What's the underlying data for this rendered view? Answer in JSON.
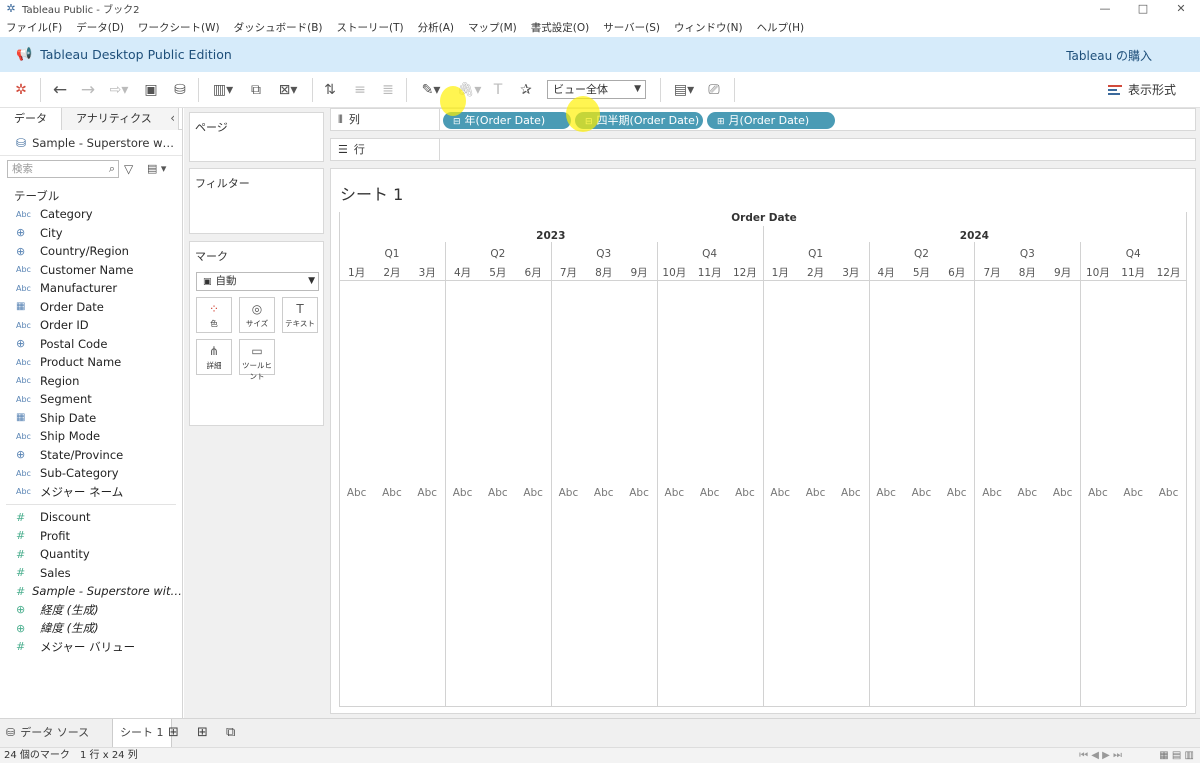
{
  "window": {
    "title": "Tableau Public - ブック2",
    "min": "—",
    "max": "□",
    "close": "✕"
  },
  "menu": [
    "ファイル(F)",
    "データ(D)",
    "ワークシート(W)",
    "ダッシュボード(B)",
    "ストーリー(T)",
    "分析(A)",
    "マップ(M)",
    "書式設定(O)",
    "サーバー(S)",
    "ウィンドウ(N)",
    "ヘルプ(H)"
  ],
  "banner": {
    "title": "Tableau Desktop Public Edition",
    "buy": "Tableau の購入"
  },
  "toolbar": {
    "view_select": "ビュー全体",
    "show_me": "表示形式"
  },
  "datapane": {
    "tab_data": "データ",
    "tab_analytics": "アナリティクス",
    "datasource": "Sample - Superstore w…",
    "search_placeholder": "検索",
    "tables_header": "テーブル",
    "dimensions": [
      {
        "name": "Category",
        "type": "abc"
      },
      {
        "name": "City",
        "type": "geo"
      },
      {
        "name": "Country/Region",
        "type": "geo"
      },
      {
        "name": "Customer Name",
        "type": "abc"
      },
      {
        "name": "Manufacturer",
        "type": "abc"
      },
      {
        "name": "Order Date",
        "type": "date"
      },
      {
        "name": "Order ID",
        "type": "abc"
      },
      {
        "name": "Postal Code",
        "type": "geo"
      },
      {
        "name": "Product Name",
        "type": "abc"
      },
      {
        "name": "Region",
        "type": "abc"
      },
      {
        "name": "Segment",
        "type": "abc"
      },
      {
        "name": "Ship Date",
        "type": "date"
      },
      {
        "name": "Ship Mode",
        "type": "abc"
      },
      {
        "name": "State/Province",
        "type": "geo"
      },
      {
        "name": "Sub-Category",
        "type": "abc"
      },
      {
        "name": "メジャー ネーム",
        "type": "abc"
      }
    ],
    "measures": [
      {
        "name": "Discount",
        "type": "num"
      },
      {
        "name": "Profit",
        "type": "num"
      },
      {
        "name": "Quantity",
        "type": "num"
      },
      {
        "name": "Sales",
        "type": "num"
      },
      {
        "name": "Sample - Superstore wit…",
        "type": "num",
        "italic": true
      },
      {
        "name": "経度 (生成)",
        "type": "geo-m",
        "italic": true
      },
      {
        "name": "緯度 (生成)",
        "type": "geo-m",
        "italic": true
      },
      {
        "name": "メジャー バリュー",
        "type": "num"
      }
    ]
  },
  "cards": {
    "pages": "ページ",
    "filters": "フィルター",
    "marks": "マーク",
    "mark_type": "自動",
    "buttons": [
      "色",
      "サイズ",
      "テキスト",
      "詳細",
      "ツールヒント"
    ]
  },
  "shelves": {
    "columns_label": "列",
    "rows_label": "行",
    "column_pills": [
      "年(Order Date)",
      "四半期(Order Date)",
      "月(Order Date)"
    ]
  },
  "sheet": {
    "title": "シート 1",
    "header": "Order Date",
    "years": [
      "2023",
      "2024"
    ],
    "quarters": [
      "Q1",
      "Q2",
      "Q3",
      "Q4"
    ],
    "months": [
      "1月",
      "2月",
      "3月",
      "4月",
      "5月",
      "6月",
      "7月",
      "8月",
      "9月",
      "10月",
      "11月",
      "12月"
    ],
    "cell_text": "Abc"
  },
  "bottom": {
    "datasource_tab": "データ ソース",
    "sheet_tab": "シート 1"
  },
  "status": {
    "marks": "24 個のマーク",
    "dims": "1 行 x 24 列"
  }
}
